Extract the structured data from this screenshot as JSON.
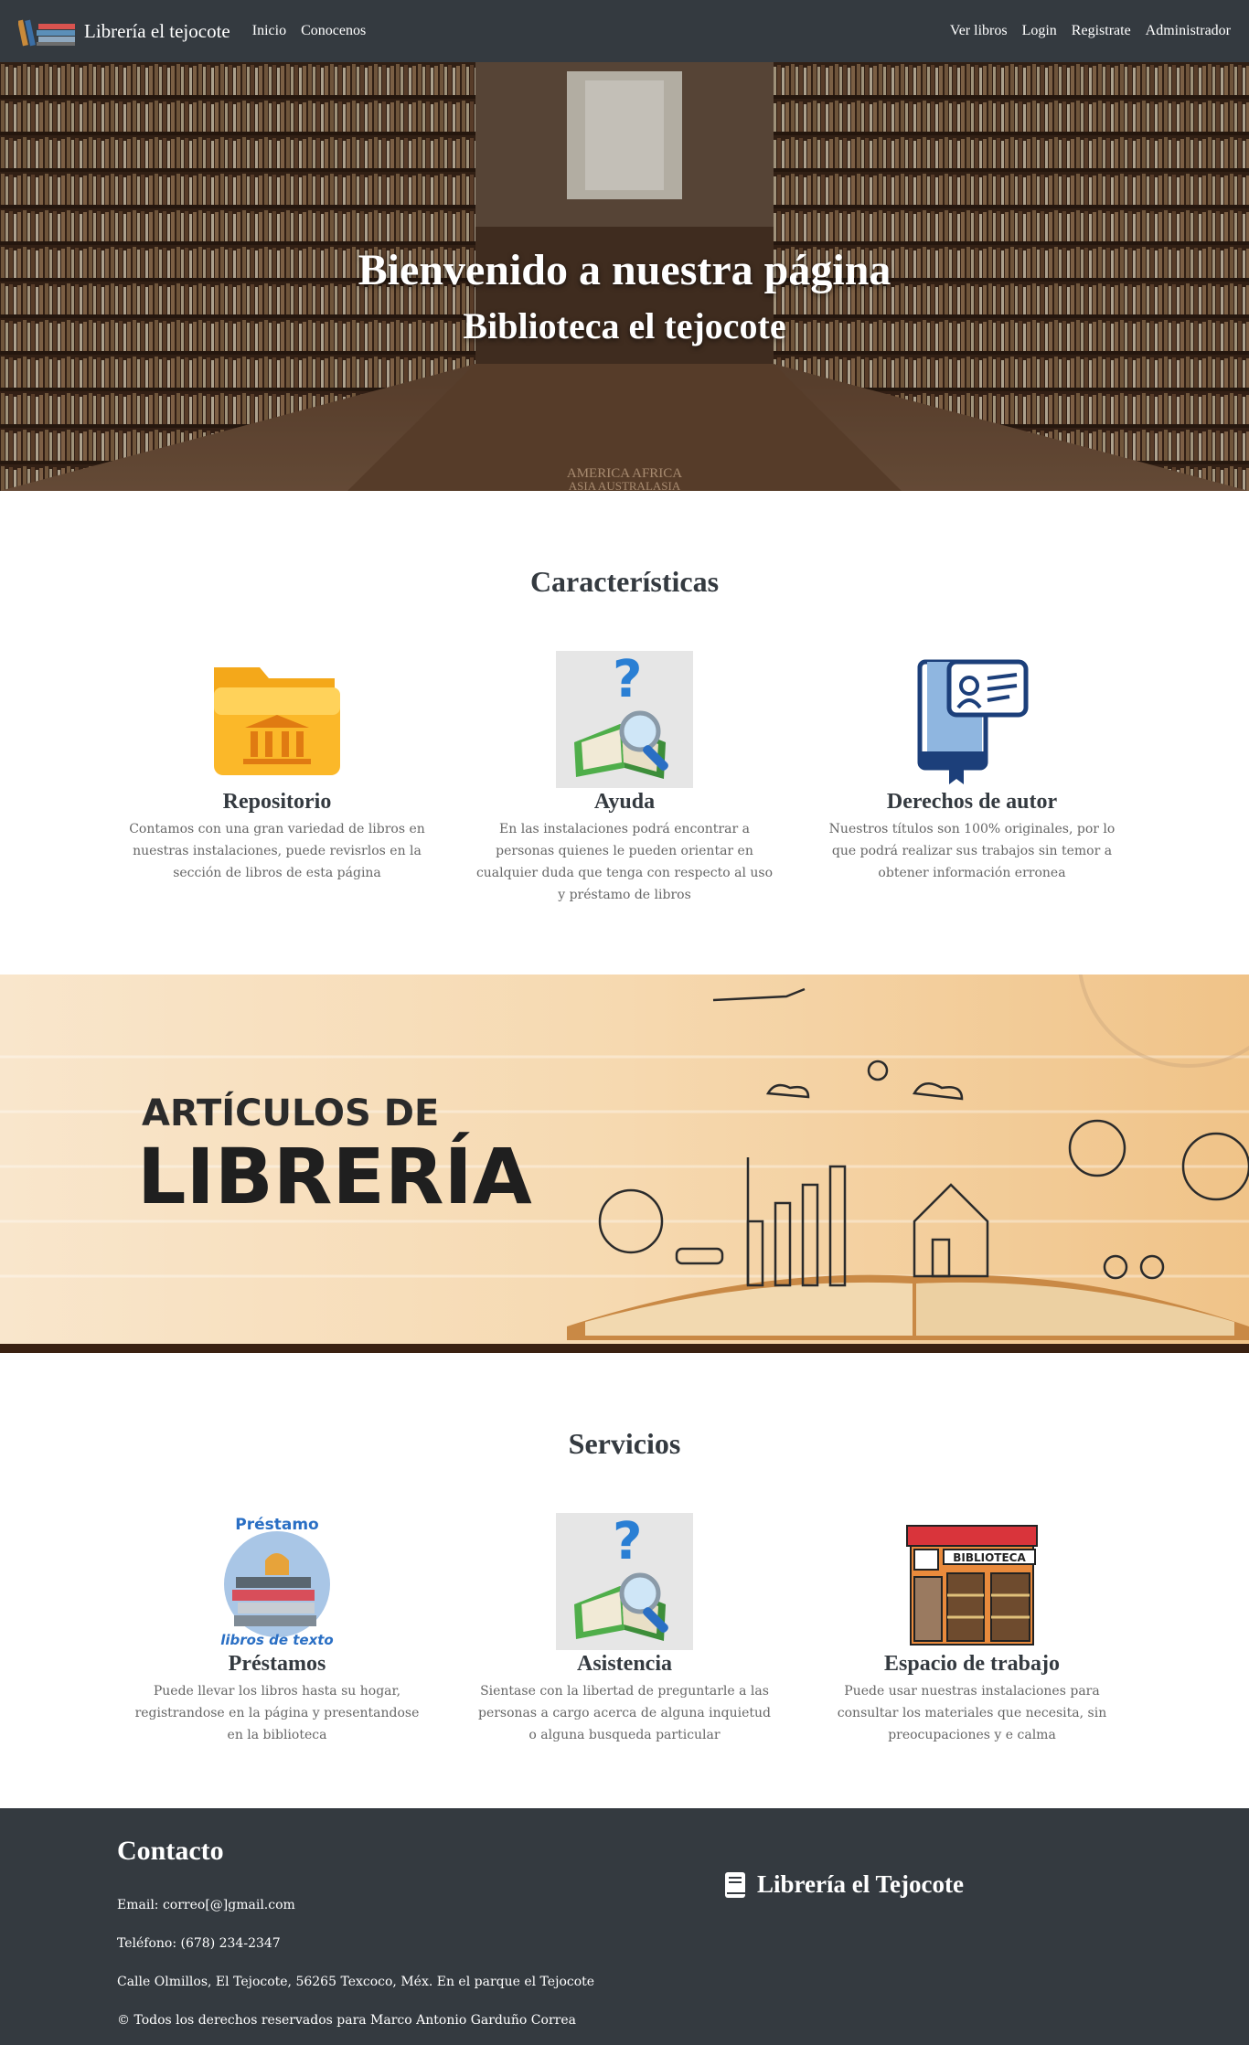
{
  "navbar": {
    "brand": "Librería el tejocote",
    "left_links": [
      "Inicio",
      "Conocenos"
    ],
    "right_links": [
      "Ver libros",
      "Login",
      "Registrate",
      "Administrador"
    ]
  },
  "hero": {
    "title": "Bienvenido a nuestra página",
    "subtitle": "Biblioteca el tejocote",
    "sign_line1": "AMERICA    AFRICA",
    "sign_line2": "ASIA    AUSTRALASIA"
  },
  "features": {
    "title": "Características",
    "cards": [
      {
        "icon": "folder-library-icon",
        "title": "Repositorio",
        "text": "Contamos con una gran variedad de libros en nuestras instalaciones, puede revisrlos en la sección de libros de esta página"
      },
      {
        "icon": "book-magnifier-question-icon",
        "title": "Ayuda",
        "text": "En las instalaciones podrá encontrar a personas quienes le pueden orientar en cualquier duda que tenga con respecto al uso y préstamo de libros"
      },
      {
        "icon": "book-id-card-icon",
        "title": "Derechos de autor",
        "text": "Nuestros títulos son 100% originales, por lo que podrá realizar sus trabajos sin temor a obtener información erronea"
      }
    ]
  },
  "banner": {
    "line1": "ARTÍCULOS DE",
    "line2": "LIBRERÍA"
  },
  "services": {
    "title": "Servicios",
    "cards": [
      {
        "icon": "book-stack-icon",
        "title": "Préstamos",
        "img_top": "Préstamo",
        "img_bottom": "libros de texto",
        "text": "Puede llevar los libros hasta su hogar, registrandose en la página y presentandose en la biblioteca"
      },
      {
        "icon": "book-magnifier-question-icon",
        "title": "Asistencia",
        "text": "Sientase con la libertad de preguntarle a las personas a cargo acerca de alguna inquietud o alguna busqueda particular"
      },
      {
        "icon": "library-building-icon",
        "title": "Espacio de trabajo",
        "img_sign": "BIBLIOTECA",
        "text": "Puede usar nuestras instalaciones para consultar los materiales que necesita, sin preocupaciones y e calma"
      }
    ]
  },
  "footer": {
    "title": "Contacto",
    "email": "Email: correo[@]gmail.com",
    "phone": "Teléfono: (678) 234-2347",
    "address": "Calle Olmillos, El Tejocote, 56265 Texcoco, Méx. En el parque el Tejocote",
    "copyright": "© Todos los derechos reservados para Marco Antonio Garduño Correa",
    "brand": "Librería el Tejocote"
  },
  "colors": {
    "navbar_bg": "#343a40",
    "footer_bg": "#343a40",
    "text": "#343a40",
    "muted_text": "#666666"
  }
}
